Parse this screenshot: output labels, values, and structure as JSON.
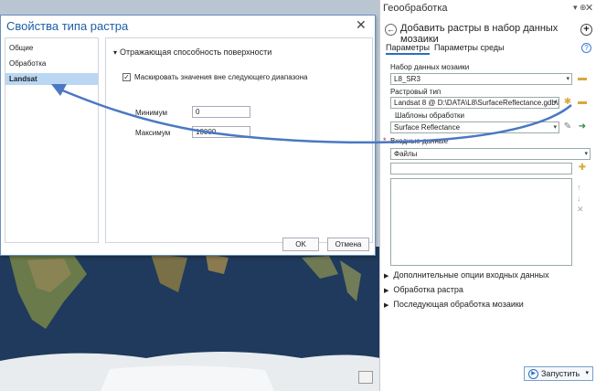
{
  "dialog": {
    "title": "Свойства типа растра",
    "close_glyph": "✕",
    "nav_items": [
      {
        "label": "Общие"
      },
      {
        "label": "Обработка"
      },
      {
        "label": "Landsat",
        "selected": true
      }
    ],
    "section_title": "Отражающая способность поверхности",
    "mask_checkbox": {
      "label": "Маскировать значения вне следующего диапазона",
      "checked": true
    },
    "min_label": "Минимум",
    "min_value": "0",
    "max_label": "Максимум",
    "max_value": "10000",
    "ok_label": "OK",
    "cancel_label": "Отмена"
  },
  "pane": {
    "title": "Геообработка",
    "pin_glyph": "▾ ⊕",
    "close_glyph": "✕",
    "back_glyph": "←",
    "tool_title": "Добавить растры в набор данных мозаики",
    "add_glyph": "+",
    "tab_params": "Параметры",
    "tab_env": "Параметры среды",
    "help_glyph": "?",
    "mosaic_label": "Набор данных мозаики",
    "mosaic_value": "L8_SR3",
    "raster_type_label": "Растровый тип",
    "raster_type_value": "Landsat 8 @ D:\\DATA\\L8\\SurfaceReflectance.gdb\\L",
    "templates_label": "Шаблоны обработки",
    "templates_value": "Surface Reflectance",
    "input_label": "Входные данные",
    "input_type_value": "Файлы",
    "groups": [
      {
        "label": "Дополнительные опции входных данных"
      },
      {
        "label": "Обработка растра"
      },
      {
        "label": "Последующая обработка мозаики"
      }
    ],
    "run_label": "Запустить"
  },
  "colors": {
    "accent": "#2a6fbd",
    "dialog_title": "#1c5fa5",
    "selection": "#b9d7f3",
    "required": "#c62828",
    "annotation_arrow": "#4a78c2"
  }
}
